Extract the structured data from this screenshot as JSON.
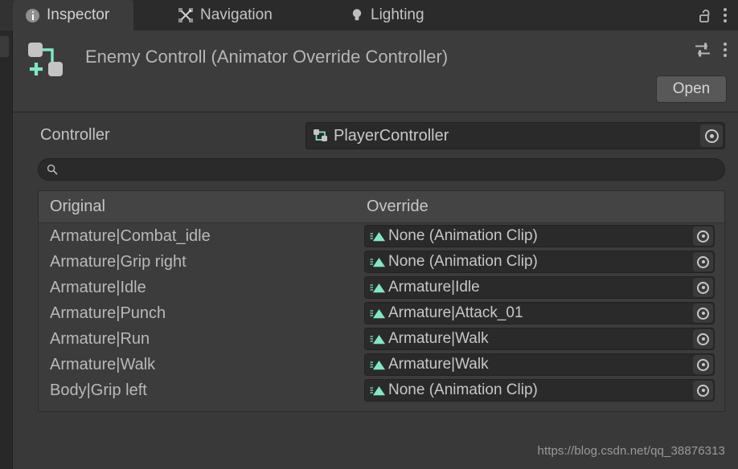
{
  "window": {
    "tabs": [
      {
        "label": "Inspector",
        "icon": "info-circle-icon",
        "active": true
      },
      {
        "label": "Navigation",
        "icon": "navigation-arrows-icon",
        "active": false
      },
      {
        "label": "Lighting",
        "icon": "lightbulb-icon",
        "active": false
      }
    ],
    "lock_icon": "unlocked-padlock-icon",
    "menu_icon": "kebab-menu-icon"
  },
  "header": {
    "object_icon": "animator-override-controller-icon",
    "title": "Enemy Controll (Animator Override Controller)",
    "preset_icon": "preset-sliders-icon",
    "menu_icon": "kebab-menu-icon",
    "open_label": "Open"
  },
  "controller_row": {
    "label": "Controller",
    "value": "PlayerController",
    "value_icon": "animator-controller-icon",
    "picker_icon": "object-picker-icon"
  },
  "search": {
    "value": "",
    "placeholder": "",
    "icon": "search-icon"
  },
  "table": {
    "columns": {
      "original": "Original",
      "override": "Override"
    },
    "rows": [
      {
        "original": "Armature|Combat_idle",
        "override": "None (Animation Clip)"
      },
      {
        "original": "Armature|Grip right",
        "override": "None (Animation Clip)"
      },
      {
        "original": "Armature|Idle",
        "override": "Armature|Idle"
      },
      {
        "original": "Armature|Punch",
        "override": "Armature|Attack_01"
      },
      {
        "original": "Armature|Run",
        "override": "Armature|Walk"
      },
      {
        "original": "Armature|Walk",
        "override": "Armature|Walk"
      },
      {
        "original": "Body|Grip left",
        "override": "None (Animation Clip)"
      }
    ],
    "clip_icon": "animation-clip-icon",
    "picker_icon": "object-picker-icon"
  },
  "watermark": "https://blog.csdn.net/qq_38876313",
  "colors": {
    "panel_bg": "#393939",
    "header_bg": "#3c3c3c",
    "tabbar_bg": "#2b2b2b",
    "field_bg": "#2a2a2a",
    "accent_mint": "#7fe9c4",
    "text": "#c4c4c4"
  }
}
